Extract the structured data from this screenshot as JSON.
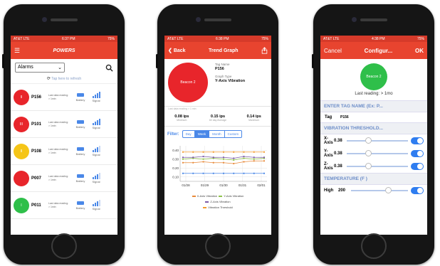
{
  "screen1": {
    "status": {
      "carrier": "AT&T LTE",
      "time": "6:37 PM",
      "battery": "75%"
    },
    "logo": "POWERS",
    "filter": {
      "selected": "Alarms"
    },
    "refresh_text": "Tap here to refresh",
    "rows": [
      {
        "tag": "P156",
        "color": "#e8252b",
        "dot_label": "II",
        "reading": "Last data reading:",
        "ago": "> 1min",
        "battery": "Battery",
        "signal": "Signal"
      },
      {
        "tag": "P101",
        "color": "#e8252b",
        "dot_label": "III",
        "reading": "Last data reading:",
        "ago": "> 1min",
        "battery": "Battery",
        "signal": "Signal"
      },
      {
        "tag": "P108",
        "color": "#f5c518",
        "dot_label": "II",
        "reading": "Last data reading:",
        "ago": "> 1min",
        "battery": "Battery",
        "signal": "Signal"
      },
      {
        "tag": "P007",
        "color": "#e8252b",
        "dot_label": "",
        "reading": "Last data reading:",
        "ago": "> 1min",
        "battery": "Battery",
        "signal": "Signal"
      },
      {
        "tag": "P011",
        "color": "#2fbf4a",
        "dot_label": "I",
        "reading": "Last data reading:",
        "ago": "> 1min",
        "battery": "Battery",
        "signal": "Signal"
      }
    ]
  },
  "screen2": {
    "status": {
      "carrier": "AT&T LTE",
      "time": "6:38 PM",
      "battery": "75%"
    },
    "back": "Back",
    "title": "Trend Graph",
    "beacon": "Beacon 2",
    "last_reading": "Last data reading > 1 min",
    "tag_name_label": "Tag Name",
    "tag_name": "P156",
    "graph_type_label": "Graph Type",
    "graph_type": "Y-Axis Vibration",
    "stats": [
      {
        "value": "0.08 ips",
        "label": "Minimum"
      },
      {
        "value": "0.15 ips",
        "label": "60 day Average"
      },
      {
        "value": "0.14 ips",
        "label": "Maximum"
      }
    ],
    "filter_label": "Filter:",
    "segments": [
      "Day",
      "Week",
      "Month",
      "Custom"
    ],
    "active_segment": "Week",
    "legend": [
      "X-Axis Vibration",
      "Y-Axis Vibration",
      "Z-Axis Vibration",
      "Vibration Threshold"
    ]
  },
  "chart_data": {
    "type": "line",
    "x": [
      "01/28",
      "01/29",
      "01/30",
      "01/31",
      "02/01"
    ],
    "yticks": [
      "0.10",
      "0.20",
      "0.30",
      "0.40"
    ],
    "ylim": [
      0.05,
      0.45
    ],
    "series": [
      {
        "name": "X-Axis Vibration",
        "color": "#e88a3a",
        "values": [
          0.26,
          0.26,
          0.27,
          0.26,
          0.26,
          0.25,
          0.27,
          0.28,
          0.28
        ]
      },
      {
        "name": "Y-Axis Vibration",
        "color": "#8ec24b",
        "values": [
          0.3,
          0.31,
          0.3,
          0.31,
          0.3,
          0.29,
          0.31,
          0.3,
          0.31
        ]
      },
      {
        "name": "Z-Axis Vibration",
        "color": "#7b5aa6",
        "values": [
          0.32,
          0.32,
          0.33,
          0.32,
          0.32,
          0.31,
          0.33,
          0.32,
          0.32
        ]
      },
      {
        "name": "Vibration Threshold",
        "color": "#f29a2e",
        "values": [
          0.38,
          0.38,
          0.38,
          0.38,
          0.38,
          0.38,
          0.38,
          0.38,
          0.38
        ]
      },
      {
        "name": "",
        "color": "#4a88e8",
        "values": [
          0.14,
          0.14,
          0.14,
          0.14,
          0.14,
          0.14,
          0.14,
          0.14,
          0.14
        ]
      }
    ]
  },
  "screen3": {
    "status": {
      "carrier": "AT&T LTE",
      "time": "4:38 PM",
      "battery": "75%"
    },
    "cancel": "Cancel",
    "title": "Configur...",
    "ok": "OK",
    "beacon": "Beacon 2",
    "last_reading": "Last reading: > 1mo",
    "section1": "ENTER TAG NAME (Ex: P...",
    "tag_label": "Tag",
    "tag_value": "P156",
    "section2": "VIBRATION THRESHOLD...",
    "axes": [
      {
        "label": "X-Axis",
        "value": "0.38",
        "level": 0.3
      },
      {
        "label": "Y-Axis",
        "value": "0.38",
        "level": 0.3
      },
      {
        "label": "Z-Axis",
        "value": "0.38",
        "level": 0.3
      }
    ],
    "section3": "TEMPERATURE (F )",
    "temp_label": "High",
    "temp_value": "200",
    "temp_level": 0.6
  }
}
